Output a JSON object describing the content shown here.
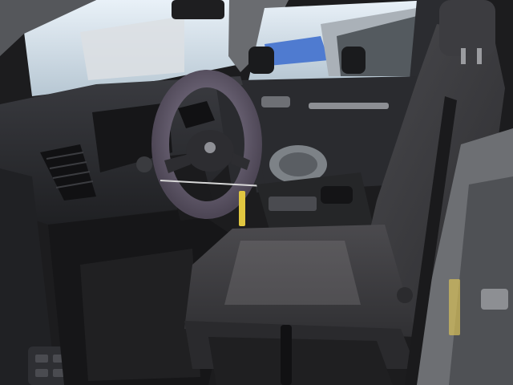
{
  "scene": {
    "subject": "car-interior-driver-side",
    "colors": {
      "sky": "#cfe0ee",
      "lot": "#9aa6b0",
      "dash": "#2c2d31",
      "dash_dark": "#1d1e21",
      "seat": "#3a3a3d",
      "seat_shadow": "#262628",
      "door_panel": "#2a2b2f",
      "body_paint": "#6d6f73",
      "floor": "#161618",
      "wheel_cover": "#5e5566",
      "wheel_cover_light": "#8a8096",
      "keychain_yellow": "#e0c640",
      "sunlight": "#7d7b7e"
    }
  }
}
